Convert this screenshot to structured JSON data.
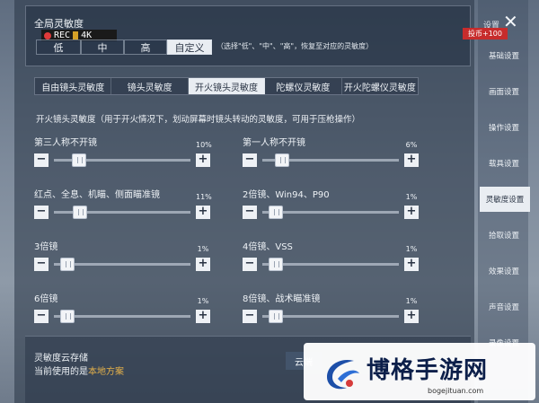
{
  "global": {
    "title": "全局灵敏度",
    "rec_label": "REC",
    "res_label": "4K",
    "presets": [
      "低",
      "中",
      "高",
      "自定义"
    ],
    "active_preset": 3,
    "hint": "（选择\"低\"、\"中\"、\"高\"，恢复至对应的灵敏度）"
  },
  "subtabs": {
    "items": [
      "自由镜头灵敏度",
      "镜头灵敏度",
      "开火镜头灵敏度",
      "陀螺仪灵敏度",
      "开火陀螺仪灵敏度"
    ],
    "active": 2
  },
  "description": "开火镜头灵敏度（用于开火情况下，划动屏幕时镜头转动的灵敏度，可用于压枪操作）",
  "sliders": [
    {
      "label": "第三人称不开镜",
      "value": "10%",
      "level": 0.1
    },
    {
      "label": "第一人称不开镜",
      "value": "6%",
      "level": 0.06
    },
    {
      "label": "红点、全息、机瞄、侧面瞄准镜",
      "value": "11%",
      "level": 0.11
    },
    {
      "label": "2倍镜、Win94、P90",
      "value": "1%",
      "level": 0.01
    },
    {
      "label": "3倍镜",
      "value": "1%",
      "level": 0.01
    },
    {
      "label": "4倍镜、VSS",
      "value": "1%",
      "level": 0.01
    },
    {
      "label": "6倍镜",
      "value": "1%",
      "level": 0.01
    },
    {
      "label": "8倍镜、战术瞄准镜",
      "value": "1%",
      "level": 0.01
    }
  ],
  "minus_symbol": "−",
  "plus_symbol": "+",
  "cloud": {
    "title": "灵敏度云存储",
    "current_prefix": "当前使用的是",
    "current_value": "本地方案",
    "button_label": "云端"
  },
  "sidebar": {
    "title": "设置",
    "close_symbol": "✕",
    "coin_badge": "投币+100",
    "items": [
      "基础设置",
      "画面设置",
      "操作设置",
      "载具设置",
      "灵敏度设置",
      "拾取设置",
      "效果设置",
      "声音设置",
      "录像设置"
    ],
    "active": 4
  },
  "watermark": {
    "name": "博格手游网",
    "url": "bogejituan.com"
  },
  "colors": {
    "accent_gold": "#e5b14a",
    "badge_red": "#c72c2c",
    "active_tab": "#e9edf2"
  }
}
